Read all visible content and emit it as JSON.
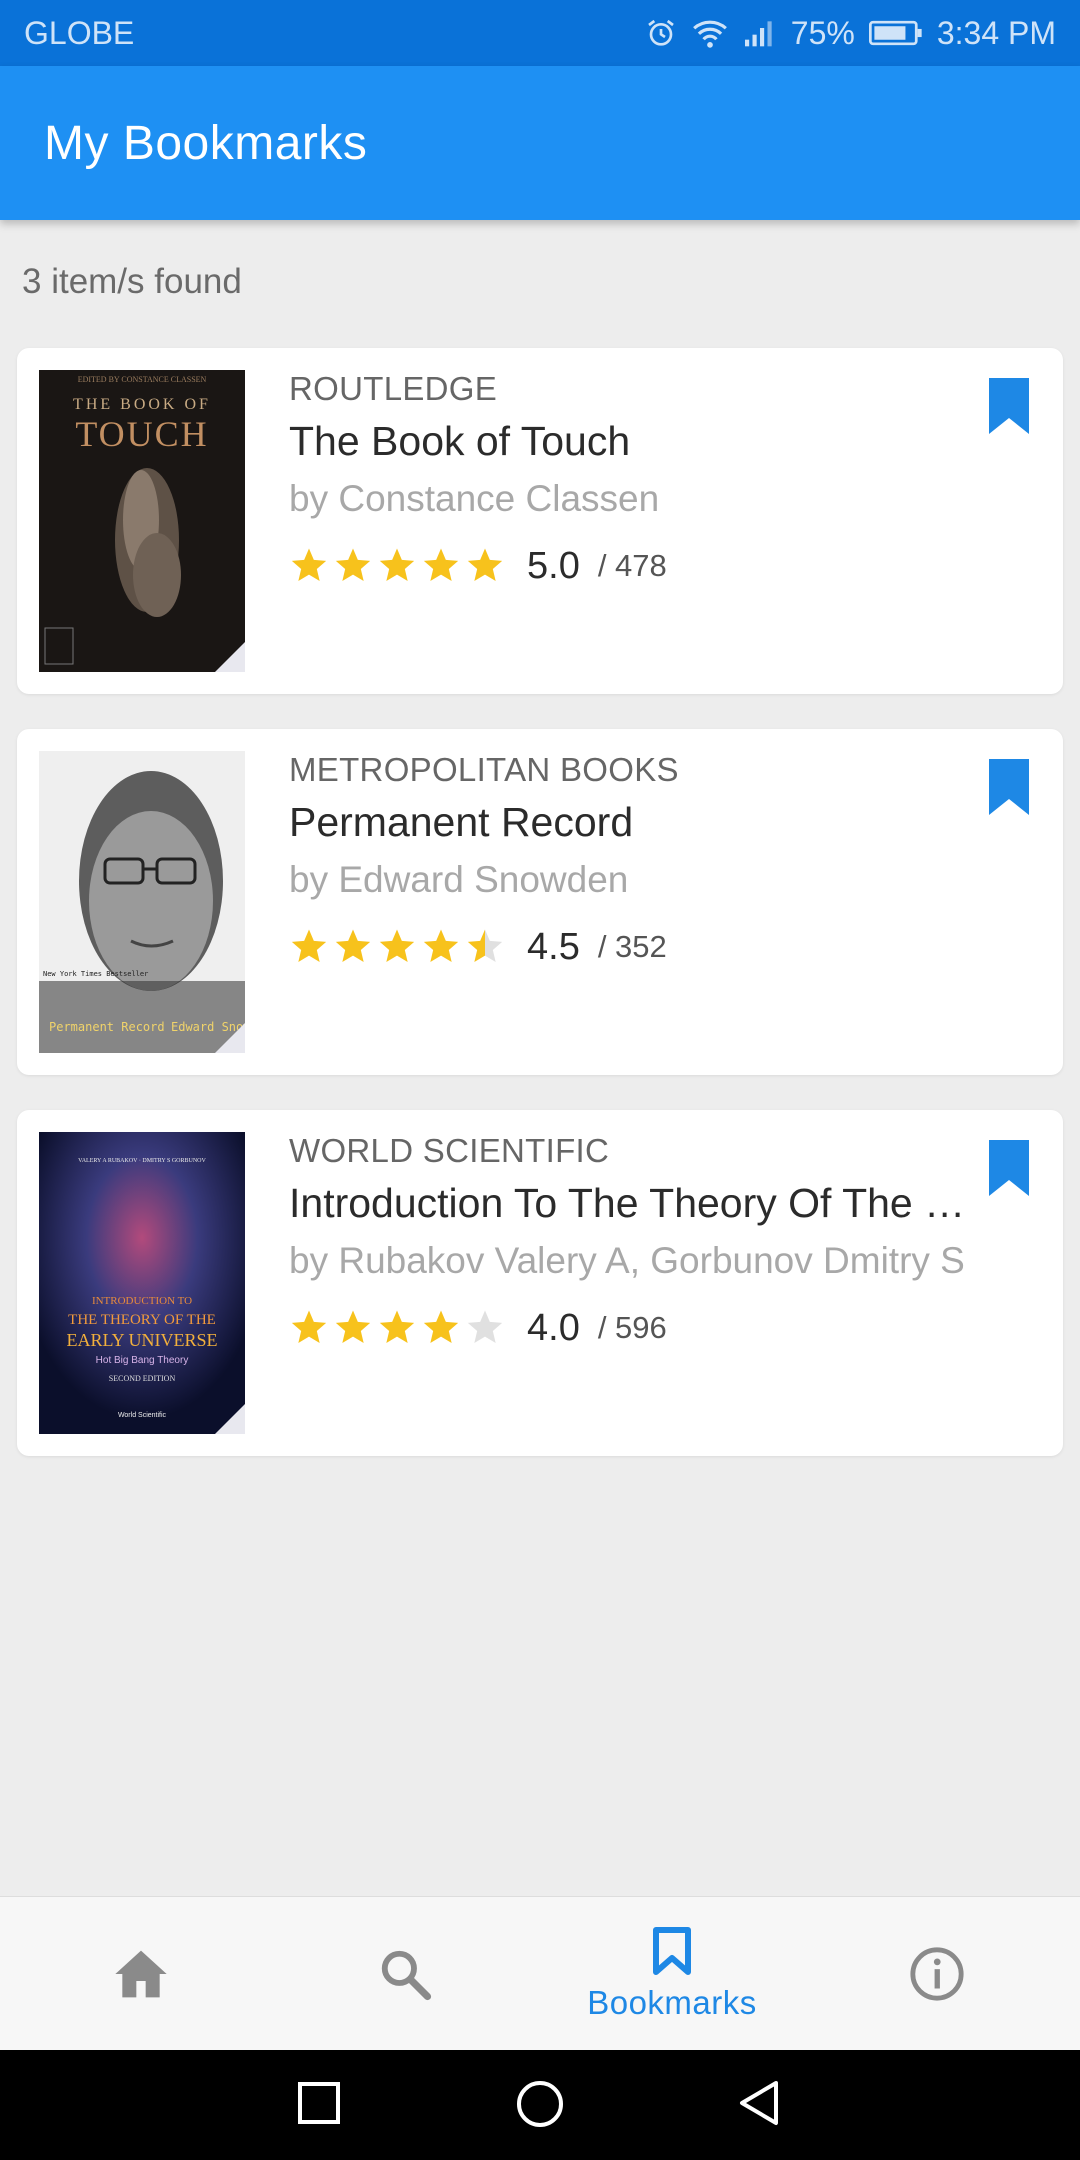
{
  "status_bar": {
    "carrier": "GLOBE",
    "battery": "75%",
    "time": "3:34 PM",
    "icons": [
      "alarm-icon",
      "wifi-icon",
      "signal-icon",
      "battery-icon"
    ]
  },
  "app_bar": {
    "title": "My Bookmarks",
    "background": "#1e90f3"
  },
  "results": {
    "count_text": "3 item/s found"
  },
  "books": [
    {
      "publisher": "ROUTLEDGE",
      "title": "The Book of Touch",
      "author": "by Constance Classen",
      "rating": "5.0",
      "rating_fraction": 1.0,
      "count": "/ 478",
      "cover": {
        "top_text": "EDITED BY CONSTANCE CLASSEN",
        "line1": "THE BOOK OF",
        "line2": "TOUCH"
      }
    },
    {
      "publisher": "METROPOLITAN BOOKS",
      "title": "Permanent Record",
      "author": "by Edward Snowden",
      "rating": "4.5",
      "rating_fraction": 0.9,
      "count": "/ 352",
      "cover": {
        "badge": "New York Times Bestseller",
        "left_text": "Permanent Record",
        "right_text": "Edward Snowd"
      }
    },
    {
      "publisher": "WORLD SCIENTIFIC",
      "title": "Introduction To The Theory Of The Early Universe",
      "author": "by Rubakov Valery A, Gorbunov Dmitry S",
      "rating": "4.0",
      "rating_fraction": 0.8,
      "count": "/ 596",
      "cover": {
        "authors": "VALERY A RUBAKOV · DMITRY S GORBUNOV",
        "line1": "INTRODUCTION TO",
        "line2": "THE THEORY OF THE",
        "line3": "EARLY UNIVERSE",
        "line4": "Hot Big Bang Theory",
        "line5": "SECOND EDITION",
        "line6": "World Scientific"
      }
    }
  ],
  "bottom_nav": {
    "items": [
      {
        "icon": "home-icon",
        "label": ""
      },
      {
        "icon": "search-icon",
        "label": ""
      },
      {
        "icon": "bookmark-icon",
        "label": "Bookmarks",
        "active": true
      },
      {
        "icon": "info-icon",
        "label": ""
      }
    ],
    "active_color": "#1e88e5",
    "inactive_color": "#8a8a8a"
  },
  "system_nav": {
    "icons": [
      "recents-icon",
      "home-circle-icon",
      "back-icon"
    ]
  },
  "colors": {
    "star": "#f7c21c",
    "star_empty": "#e0e0e0",
    "bookmark": "#1e88e5"
  }
}
